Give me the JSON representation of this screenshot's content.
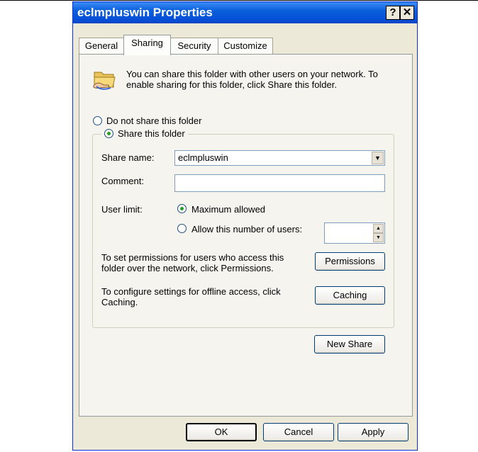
{
  "window": {
    "title": "eclmpluswin Properties",
    "help_label": "?",
    "close_label": "✕"
  },
  "tabs": [
    {
      "label": "General",
      "selected": false
    },
    {
      "label": "Sharing",
      "selected": true
    },
    {
      "label": "Security",
      "selected": false
    },
    {
      "label": "Customize",
      "selected": false
    }
  ],
  "sharing": {
    "icon": "shared-folder-icon",
    "intro": "You can share this folder with other users on your network.  To enable sharing for this folder, click Share this folder.",
    "option_no_share": "Do not share this folder",
    "option_share": "Share this folder",
    "selected_option": "share",
    "share_name_label": "Share name:",
    "share_name_value": "eclmpluswin",
    "comment_label": "Comment:",
    "comment_value": "",
    "user_limit_label": "User limit:",
    "limit_max": "Maximum allowed",
    "limit_number": "Allow this number of users:",
    "selected_limit": "max",
    "users_value": "",
    "permissions_text": "To set permissions for users who access this folder over the network, click Permissions.",
    "permissions_button": "Permissions",
    "caching_text": "To configure settings for offline access, click Caching.",
    "caching_button": "Caching",
    "new_share_button": "New Share"
  },
  "buttons": {
    "ok": "OK",
    "cancel": "Cancel",
    "apply": "Apply"
  },
  "colors": {
    "titlebar": "#0a5fdc",
    "dialog_bg": "#ece9d8",
    "panel_bg": "#f5f4ee",
    "radio_dot": "#21a121"
  }
}
